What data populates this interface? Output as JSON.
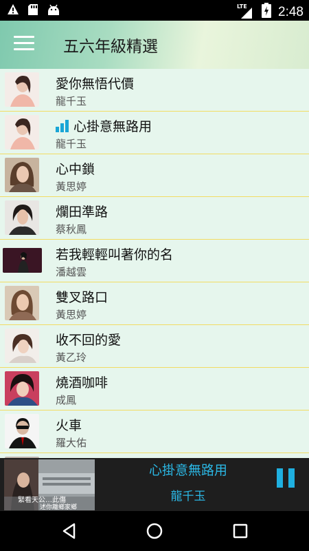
{
  "status_bar": {
    "time": "2:48",
    "network": "LTE",
    "icons": [
      "warning-icon",
      "sd-card-icon",
      "android-icon",
      "signal-icon",
      "battery-charging-icon"
    ]
  },
  "app_bar": {
    "title": "五六年級精選",
    "menu_icon": "menu-icon"
  },
  "songs": [
    {
      "title": "愛你無悟代價",
      "artist": "龍千玉",
      "playing": false
    },
    {
      "title": "心掛意無路用",
      "artist": "龍千玉",
      "playing": true
    },
    {
      "title": "心中鎖",
      "artist": "黃思婷",
      "playing": false
    },
    {
      "title": "爛田準路",
      "artist": "蔡秋鳳",
      "playing": false
    },
    {
      "title": "若我輕輕叫著你的名",
      "artist": "潘越雲",
      "playing": false
    },
    {
      "title": "雙叉路口",
      "artist": "黃思婷",
      "playing": false
    },
    {
      "title": "收不回的愛",
      "artist": "黃乙玲",
      "playing": false
    },
    {
      "title": "燒酒咖啡",
      "artist": "成鳳",
      "playing": false
    },
    {
      "title": "火車",
      "artist": "羅大佑",
      "playing": false
    }
  ],
  "now_playing": {
    "title": "心掛意無路用",
    "artist": "龍千玉",
    "art_caption_line1": "緊看天公…此傷",
    "art_caption_line2": "述你離鄉家鄉",
    "pause_icon": "pause-icon"
  },
  "nav_bar": {
    "icons": [
      "back-icon",
      "home-icon",
      "recents-icon"
    ]
  },
  "colors": {
    "accent": "#2bb7e4",
    "divider": "#f2dc62",
    "list_bg": "#e6f6ed"
  }
}
